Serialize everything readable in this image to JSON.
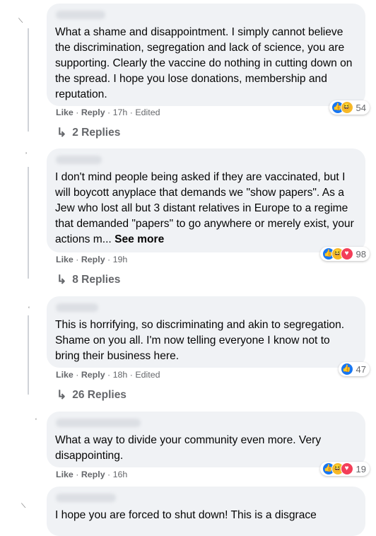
{
  "colors": {
    "bubble": "#f0f2f5",
    "secondary_text": "#65676b",
    "like_blue": "#1877f2",
    "haha_yellow": "#f7b928",
    "love_red": "#f33e58"
  },
  "action_labels": {
    "like": "Like",
    "reply": "Reply",
    "separator": "·"
  },
  "comments": [
    {
      "text": "What a shame and disappointment. I simply cannot believe the discrimination, segregation and lack of science, you are supporting. Clearly the vaccine do nothing in cutting down on the spread. I hope you lose donations, membership and reputation.",
      "reactions": [
        "like",
        "haha"
      ],
      "reaction_count": "54",
      "time": "17h",
      "edited": "Edited",
      "replies": "2 Replies"
    },
    {
      "text": "I don't mind people being asked if they are vaccinated, but I will boycott anyplace that demands we \"show papers\". As a Jew who lost all but 3 distant relatives in Europe to a regime that demanded \"papers\" to go anywhere or merely exist, your actions m...",
      "see_more": "See more",
      "reactions": [
        "like",
        "haha",
        "love"
      ],
      "reaction_count": "98",
      "time": "19h",
      "replies": "8 Replies"
    },
    {
      "text": "This is horrifying, so discriminating and akin to segregation. Shame on you all. I'm now telling everyone I know not to bring their business here.",
      "reactions": [
        "like"
      ],
      "reaction_count": "47",
      "time": "18h",
      "edited": "Edited",
      "replies": "26 Replies"
    },
    {
      "text": "What a way to divide your community even more. Very disappointing.",
      "reactions": [
        "like",
        "haha",
        "love"
      ],
      "reaction_count": "19",
      "time": "16h"
    },
    {
      "text": "I hope you are forced to shut down! This is a disgrace"
    }
  ]
}
